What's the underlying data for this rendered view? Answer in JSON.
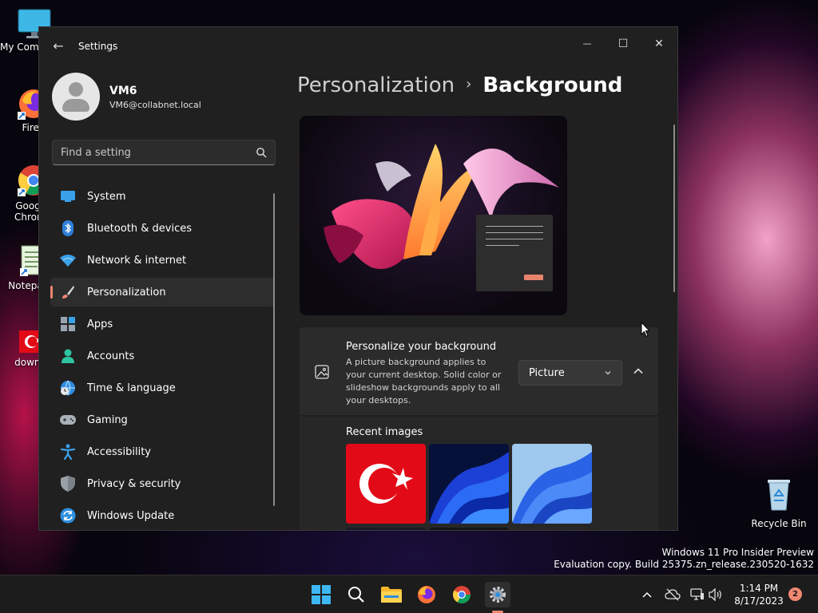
{
  "desktop": {
    "icons": [
      {
        "label": "My Com"
      },
      {
        "label": "Firefo"
      },
      {
        "label": "Goog Chron"
      },
      {
        "label": "Notepa"
      },
      {
        "label": "downl"
      }
    ],
    "recycle_bin": "Recycle Bin"
  },
  "window": {
    "title": "Settings",
    "back_glyph": "←",
    "minimize_glyph": "—",
    "maximize_glyph": "☐",
    "close_glyph": "✕"
  },
  "profile": {
    "name": "VM6",
    "email": "VM6@collabnet.local"
  },
  "search": {
    "placeholder": "Find a setting"
  },
  "sidebar": {
    "items": [
      {
        "label": "System",
        "icon": "system-icon"
      },
      {
        "label": "Bluetooth & devices",
        "icon": "bluetooth-icon"
      },
      {
        "label": "Network & internet",
        "icon": "network-icon"
      },
      {
        "label": "Personalization",
        "icon": "brush-icon",
        "selected": true
      },
      {
        "label": "Apps",
        "icon": "apps-icon"
      },
      {
        "label": "Accounts",
        "icon": "accounts-icon"
      },
      {
        "label": "Time & language",
        "icon": "time-language-icon"
      },
      {
        "label": "Gaming",
        "icon": "gaming-icon"
      },
      {
        "label": "Accessibility",
        "icon": "accessibility-icon"
      },
      {
        "label": "Privacy & security",
        "icon": "shield-icon"
      },
      {
        "label": "Windows Update",
        "icon": "update-icon"
      }
    ]
  },
  "breadcrumb": {
    "parent": "Personalization",
    "separator": "›",
    "current": "Background"
  },
  "background_card": {
    "title": "Personalize your background",
    "description": "A picture background applies to your current desktop. Solid color or slideshow backgrounds apply to all your desktops.",
    "dropdown_value": "Picture"
  },
  "recent_images": {
    "label": "Recent images"
  },
  "watermark": {
    "line1": "Windows 11 Pro Insider Preview",
    "line2": "Evaluation copy. Build 25375.zn_release.230520-1632"
  },
  "taskbar": {
    "time": "1:14 PM",
    "date": "8/17/2023",
    "notification_count": "2"
  },
  "colors": {
    "accent": "#f08770",
    "window_bg": "#202020",
    "card_bg": "#2b2b2b"
  }
}
